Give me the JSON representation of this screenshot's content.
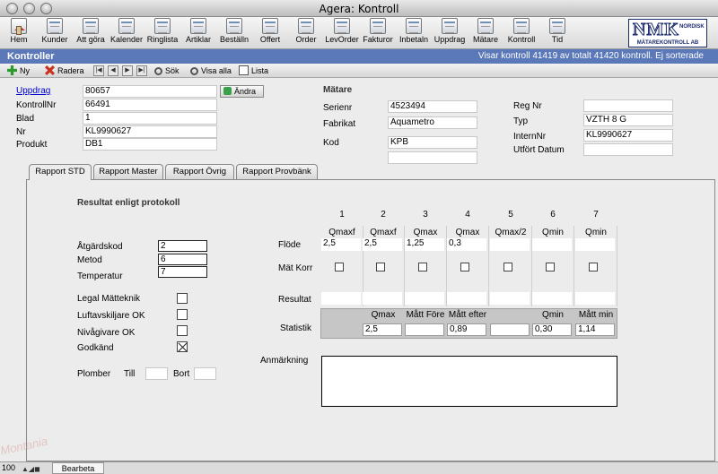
{
  "window": {
    "title": "Agera: Kontroll"
  },
  "toolbar": {
    "buttons": [
      {
        "label": "Hem",
        "icon": "home-icon"
      },
      {
        "label": "Kunder",
        "icon": "calendar-icon"
      },
      {
        "label": "Att göra",
        "icon": "calendar-icon"
      },
      {
        "label": "Kalender",
        "icon": "calendar-icon"
      },
      {
        "label": "Ringlista",
        "icon": "calendar-icon"
      },
      {
        "label": "Artiklar",
        "icon": "calendar-icon"
      },
      {
        "label": "Beställn",
        "icon": "calendar-icon"
      },
      {
        "label": "Offert",
        "icon": "calendar-icon"
      },
      {
        "label": "Order",
        "icon": "calendar-icon"
      },
      {
        "label": "LevOrder",
        "icon": "calendar-icon"
      },
      {
        "label": "Fakturor",
        "icon": "calendar-icon"
      },
      {
        "label": "Inbetaln",
        "icon": "calendar-icon"
      },
      {
        "label": "Uppdrag",
        "icon": "calendar-icon"
      },
      {
        "label": "Mätare",
        "icon": "calendar-icon"
      },
      {
        "label": "Kontroll",
        "icon": "calendar-icon"
      },
      {
        "label": "Tid",
        "icon": "calendar-icon"
      }
    ],
    "logo": {
      "big": "NMK",
      "small": "MÄTAREKONTROLL AB",
      "side": "NORDISK"
    }
  },
  "header": {
    "title": "Kontroller",
    "status": "Visar kontroll 41419 av totalt 41420 kontroll. Ej sorterade"
  },
  "actions": {
    "new": "Ny",
    "delete": "Radera",
    "search": "Sök",
    "show_all": "Visa alla",
    "list": "Lista"
  },
  "form": {
    "uppdrag_label": "Uppdrag",
    "uppdrag_value": "80657",
    "andra_button": "Ändra",
    "kontrollnr_label": "KontrollNr",
    "kontrollnr_value": "66491",
    "blad_label": "Blad",
    "blad_value": "1",
    "nr_label": "Nr",
    "nr_value": "KL9990627",
    "produkt_label": "Produkt",
    "produkt_value": "DB1"
  },
  "meter": {
    "title": "Mätare",
    "serienr_label": "Serienr",
    "serienr_value": "4523494",
    "fabrikat_label": "Fabrikat",
    "fabrikat_value": "Aquametro",
    "kod_label": "Kod",
    "kod_value": "KPB",
    "regnr_label": "Reg Nr",
    "regnr_value": "",
    "typ_label": "Typ",
    "typ_value": "VZTH 8 G",
    "internnr_label": "InternNr",
    "internnr_value": "KL9990627",
    "utfort_label": "Utfört Datum",
    "utfort_value": ""
  },
  "tabs": [
    "Rapport STD",
    "Rapport Master",
    "Rapport Övrig",
    "Rapport Provbänk"
  ],
  "report": {
    "section_title": "Resultat enligt protokoll",
    "atgardskod_label": "Åtgärdskod",
    "atgardskod_value": "2",
    "metod_label": "Metod",
    "metod_value": "6",
    "temperatur_label": "Temperatur",
    "temperatur_value": "7",
    "legal_label": "Legal Mätteknik",
    "legal_checked": false,
    "luftavskiljare_label": "Luftavskiljare OK",
    "luftavskiljare_checked": false,
    "nivagivare_label": "Nivågivare OK",
    "nivagivare_checked": false,
    "godkand_label": "Godkänd",
    "godkand_checked": true,
    "plomber_label": "Plomber",
    "till_label": "Till",
    "till_value": "",
    "bort_label": "Bort",
    "bort_value": "",
    "columns": [
      "1",
      "2",
      "3",
      "4",
      "5",
      "6",
      "7"
    ],
    "flow_types": [
      "Qmaxf",
      "Qmaxf",
      "Qmax",
      "Qmax",
      "Qmax/2",
      "Qmin",
      "Qmin"
    ],
    "flode_label": "Flöde",
    "flode_values": [
      "2,5",
      "2,5",
      "1,25",
      "0,3",
      "",
      "",
      ""
    ],
    "matkorr_label": "Mät Korr",
    "resultat_label": "Resultat",
    "statistik_label": "Statistik",
    "stat_headers": [
      "Qmax",
      "Mått Före",
      "Mått efter",
      "",
      "Qmin",
      "Mått min"
    ],
    "stat_values": [
      "2,5",
      "",
      "0,89",
      "",
      "0,30",
      "1,14"
    ],
    "anmarkning_label": "Anmärkning",
    "anmarkning_value": ""
  },
  "statusbar": {
    "zoom": "100",
    "mode": "Bearbeta"
  },
  "watermark": "Montania"
}
